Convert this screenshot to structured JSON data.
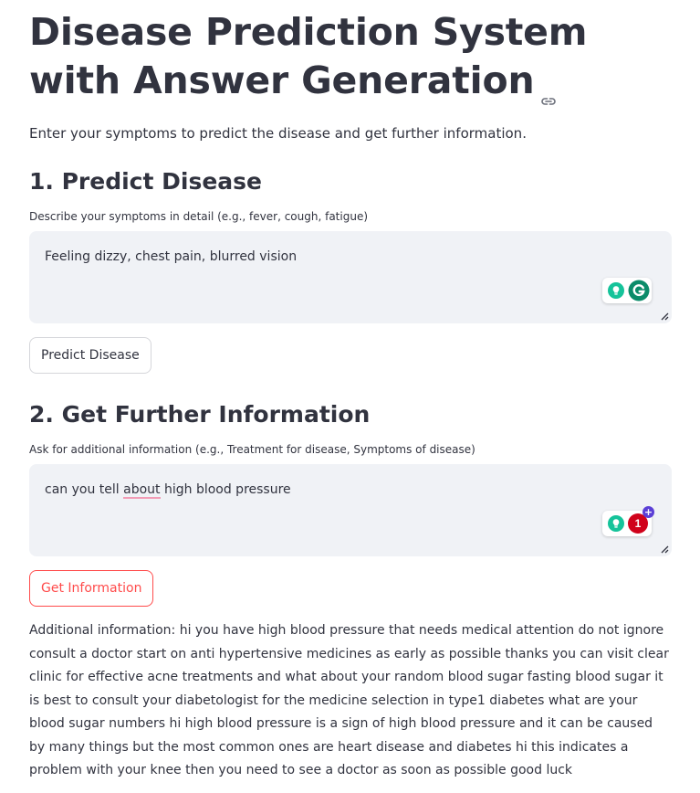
{
  "header": {
    "title": "Disease Prediction System with Answer Generation",
    "intro": "Enter your symptoms to predict the disease and get further information."
  },
  "predict": {
    "heading": "1. Predict Disease",
    "label": "Describe your symptoms in detail (e.g., fever, cough, fatigue)",
    "value": "Feeling dizzy, chest pain, blurred vision",
    "button_label": "Predict Disease"
  },
  "info": {
    "heading": "2. Get Further Information",
    "label": "Ask for additional information (e.g., Treatment for disease, Symptoms of disease)",
    "value_before": "can you tell ",
    "value_flagged": "about",
    "value_after": " high blood pressure",
    "button_label": "Get Information",
    "grammarly_count": "1",
    "grammarly_plus": "+"
  },
  "result": {
    "text": "Additional information: hi you have high blood pressure that needs medical attention do not ignore consult a doctor start on anti hypertensive medicines as early as possible thanks you can visit clear clinic for effective acne treatments and what about your random blood sugar fasting blood sugar it is best to consult your diabetologist for the medicine selection in type1 diabetes what are your blood sugar numbers hi high blood pressure is a sign of high blood pressure and it can be caused by many things but the most common ones are heart disease and diabetes hi this indicates a problem with your knee then you need to see a doctor as soon as possible good luck"
  },
  "icons": {
    "anchor": "link-icon",
    "resize": "resize-handle-icon",
    "bulb": "lightbulb-icon",
    "grammarly": "grammarly-icon"
  },
  "colors": {
    "text": "#31333f",
    "input_bg": "#f0f2f6",
    "accent": "#ff4b4b",
    "grammarly_green": "#15c39a",
    "grammarly_logo": "#0b8c6a",
    "grammarly_red": "#d0021b",
    "squiggle": "#f29cb6"
  }
}
